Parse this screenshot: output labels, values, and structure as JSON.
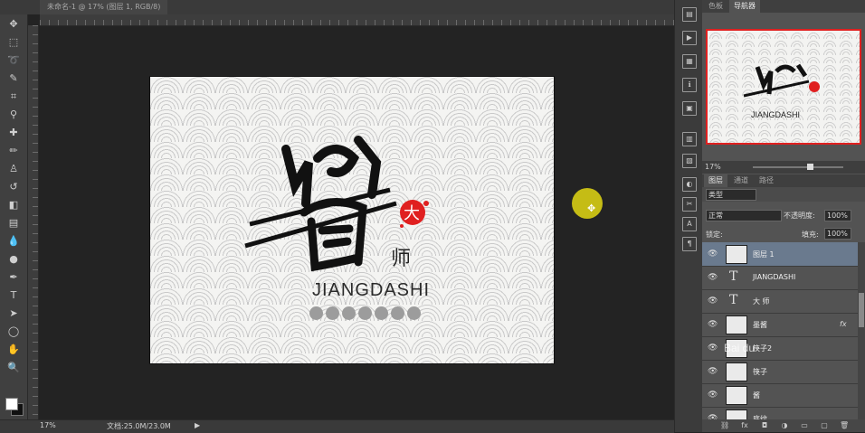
{
  "document_tab": "未命名-1 @ 17% (图层 1, RGB/8)",
  "toolbar": {
    "tools": [
      "move",
      "marquee",
      "lasso",
      "quick-select",
      "crop",
      "eyedropper",
      "healing",
      "brush",
      "clone",
      "history-brush",
      "eraser",
      "gradient",
      "blur",
      "dodge",
      "pen",
      "type",
      "path-select",
      "shape",
      "hand",
      "zoom"
    ]
  },
  "canvas": {
    "brand_name": "JIANGDASHI",
    "seal_char": "大",
    "dashi_char": "师",
    "dot_count": 7
  },
  "status": {
    "zoom": "17%",
    "doc_size": "文档:25.0M/23.0M",
    "arrow": "▶"
  },
  "nav_panel": {
    "tabs": [
      "色板",
      "导航器"
    ],
    "active_tab": "导航器",
    "preview_text": "JIANGDASHI",
    "zoom": "17%"
  },
  "layers_panel": {
    "tabs": [
      "图层",
      "通道",
      "路径"
    ],
    "active_tab": "图层",
    "kind_filter": "类型",
    "blend_mode": "正常",
    "opacity_label": "不透明度:",
    "opacity_value": "100%",
    "lock_label": "锁定:",
    "fill_label": "填充:",
    "fill_value": "100%",
    "layers": [
      {
        "name": "图层 1",
        "type": "pixel",
        "selected": true,
        "fx": ""
      },
      {
        "name": "JIANGDASHI",
        "type": "text",
        "selected": false,
        "fx": ""
      },
      {
        "name": "大 师",
        "type": "text",
        "selected": false,
        "fx": ""
      },
      {
        "name": "墨酱",
        "type": "pixel",
        "selected": false,
        "fx": "fx"
      },
      {
        "name": "筷子2",
        "type": "pixel",
        "selected": false,
        "fx": ""
      },
      {
        "name": "筷子",
        "type": "pixel",
        "selected": false,
        "fx": ""
      },
      {
        "name": "酱",
        "type": "pixel",
        "selected": false,
        "fx": ""
      },
      {
        "name": "底纹",
        "type": "pixel",
        "selected": false,
        "fx": ""
      }
    ]
  },
  "watermark": "Bai du",
  "colors": {
    "accent_red": "#e02020",
    "cursor_highlight": "#d7cd14",
    "selected_layer": "#6a7a8e"
  }
}
